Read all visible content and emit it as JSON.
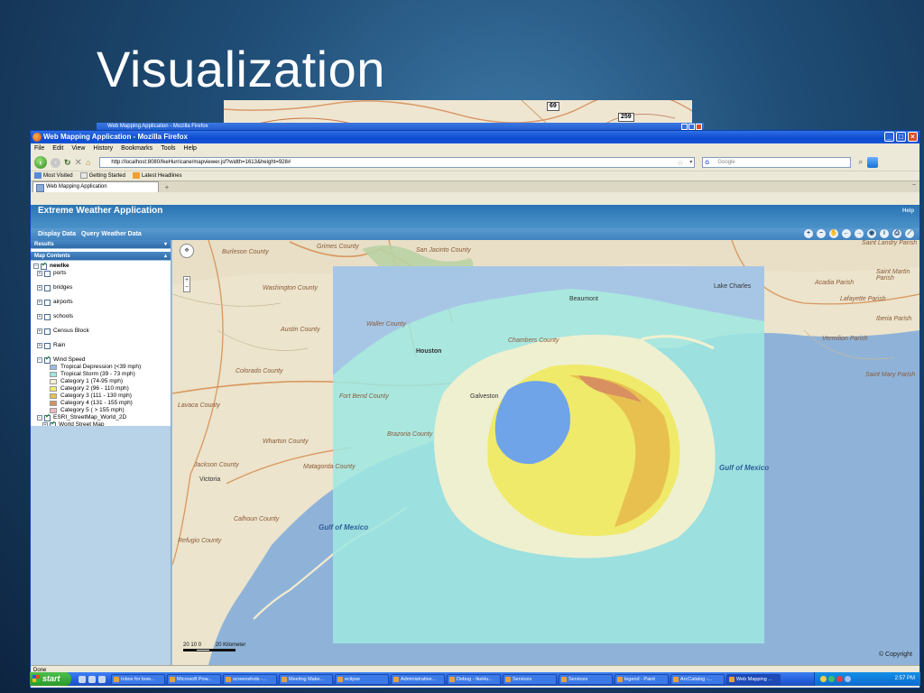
{
  "slide": {
    "title": "Visualization"
  },
  "background_map": {
    "shields": [
      "69",
      "259"
    ]
  },
  "back_window": {
    "title": "Web Mapping Application - Mozilla Firefox"
  },
  "browser": {
    "title": "Web Mapping Application - Mozilla Firefox",
    "menu": [
      "File",
      "Edit",
      "View",
      "History",
      "Bookmarks",
      "Tools",
      "Help"
    ],
    "url": "http://localhost:8080/IkeHurricane/mapviewer.jsf?width=1613&height=928#",
    "search_placeholder": "Google",
    "bookmarks": [
      "Most Visited",
      "Getting Started",
      "Latest Headlines"
    ],
    "tab_label": "Web Mapping Application",
    "status": "Done"
  },
  "app": {
    "header_title": "Extreme Weather Application",
    "help_label": "Help",
    "nav": [
      "Display Data",
      "Query Weather Data"
    ],
    "results_label": "Results",
    "map_contents_label": "Map Contents"
  },
  "toc": {
    "root": "newlke",
    "layers": [
      "ports",
      "bridges",
      "airports",
      "schools",
      "Census Block",
      "Rain"
    ],
    "wind_speed": {
      "label": "Wind Speed",
      "classes": [
        {
          "label": "Tropical Depression (<39 mph)",
          "color": "#9bb8e8"
        },
        {
          "label": "Tropical Storm (39 - 73 mph)",
          "color": "#9ee8e0"
        },
        {
          "label": "Category 1 (74-95 mph)",
          "color": "#f2f0cf"
        },
        {
          "label": "Category 2 (96 - 110 mph)",
          "color": "#f0ea6a"
        },
        {
          "label": "Category 3 (111 - 130 mph)",
          "color": "#e8c050"
        },
        {
          "label": "Category 4 (131 - 155 mph)",
          "color": "#d89060"
        },
        {
          "label": "Category 5 ( > 155 mph)",
          "color": "#f0b8c0"
        }
      ]
    },
    "basemap_group": "ESRI_StreetMap_World_2D",
    "basemap_layer": "World Street Map"
  },
  "map": {
    "labels": [
      "Burleson County",
      "Washington County",
      "Grimes County",
      "San Jacinto County",
      "Austin County",
      "Waller County",
      "Houston",
      "Beaumont",
      "Lake Charles",
      "Colorado County",
      "Fort Bend County",
      "Brazoria County",
      "Wharton County",
      "Matagorda County",
      "Victoria",
      "Calhoun County",
      "Acadia Parish",
      "Lafayette Parish",
      "Saint Martin Parish",
      "Iberia Parish",
      "Vermilion Parish",
      "Saint Mary Parish",
      "Saint Landry Parish",
      "Jackson County",
      "Galveston",
      "Chambers County",
      "Refugio County",
      "Lavaca County"
    ],
    "gulf_labels": [
      "Gulf of Mexico",
      "Gulf of Mexico"
    ],
    "scale_ticks": [
      "20",
      "10",
      "0",
      "20 Kilometer"
    ],
    "copyright": "© Copyright"
  },
  "taskbar": {
    "start": "start",
    "tasks": [
      "Inbox for bow...",
      "Microsoft Pow...",
      "screenshots -...",
      "Meeting Make...",
      "eclipse",
      "Administrative...",
      "Debug - IkeHu...",
      "Services",
      "Services",
      "legend - Paint",
      "ArcCatalog -...",
      "Web Mapping ..."
    ],
    "clock": "2:57 PM"
  }
}
